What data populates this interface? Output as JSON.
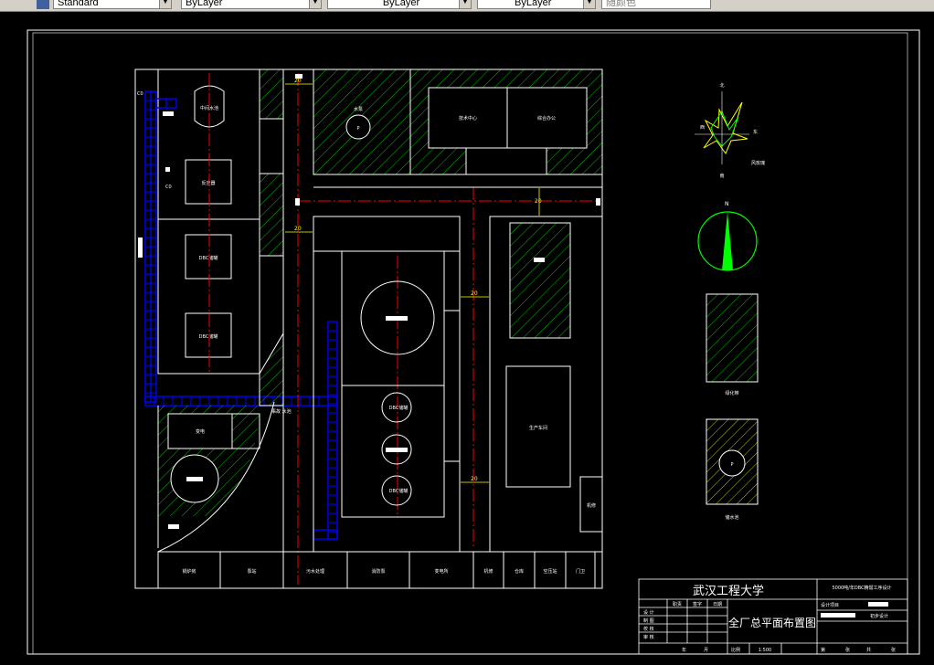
{
  "toolbar": {
    "text_style": "Standard",
    "layer": "ByLayer",
    "linetype": "ByLayer",
    "lineweight": "ByLayer",
    "plot_style": "随颜色"
  },
  "colors": {
    "background": "#000000",
    "lines": "#ffffff",
    "hatch": "#00c000",
    "axis": "#ff0000",
    "stair": "#0000ff",
    "dimension": "#ffff00",
    "compass": "#00ff00"
  },
  "drawing": {
    "buildings": {
      "tank_top": "中间水池",
      "reactor": "反应器",
      "dbo1": "DBC储罐",
      "dbo2": "DBC储罐",
      "circle_top": "P",
      "circle_top_label": "水泵",
      "tech_center": "技术中心",
      "office": "综合办公",
      "stair_label": "事故\n水池",
      "left_small": "变电",
      "tank_mid1": "DBC储罐",
      "tank_mid3": "DBC储罐",
      "workshop": "生产车间",
      "right_small": "机修",
      "left_c1": "C0",
      "left_c2": "C0",
      "circle_bottom": "P"
    },
    "bottom_row": [
      "锅炉房",
      "泵站",
      "污水处理",
      "消防泵",
      "变电所",
      "机修",
      "仓库",
      "空压站",
      "门卫"
    ],
    "dims": {
      "d1": "20",
      "d2": "20",
      "d3": "20",
      "d4": "20",
      "d5": "20"
    },
    "wind_rose": {
      "north": "北",
      "west": "西",
      "east": "东",
      "south": "南",
      "note": "风玫瑰"
    },
    "compass_label": "N",
    "legend": {
      "greenery": "绿化带",
      "reservoir": "储水池"
    }
  },
  "title_block": {
    "university": "武汉工程大学",
    "project": "5000吨/年DBC精馏工序设计",
    "drawing_title": "全厂总平面布置图",
    "design_item": "设计项目",
    "course_design": "初步设计",
    "roles": [
      "职责",
      "签字",
      "日期"
    ],
    "rows": [
      "设 计",
      "制 图",
      "校 核",
      "审 核"
    ],
    "scale_label": "比例",
    "scale_value": "1:500",
    "year": "年",
    "month": "月",
    "sheet_a": "第",
    "sheet_b": "张",
    "sheet_c": "共",
    "sheet_d": "张"
  }
}
